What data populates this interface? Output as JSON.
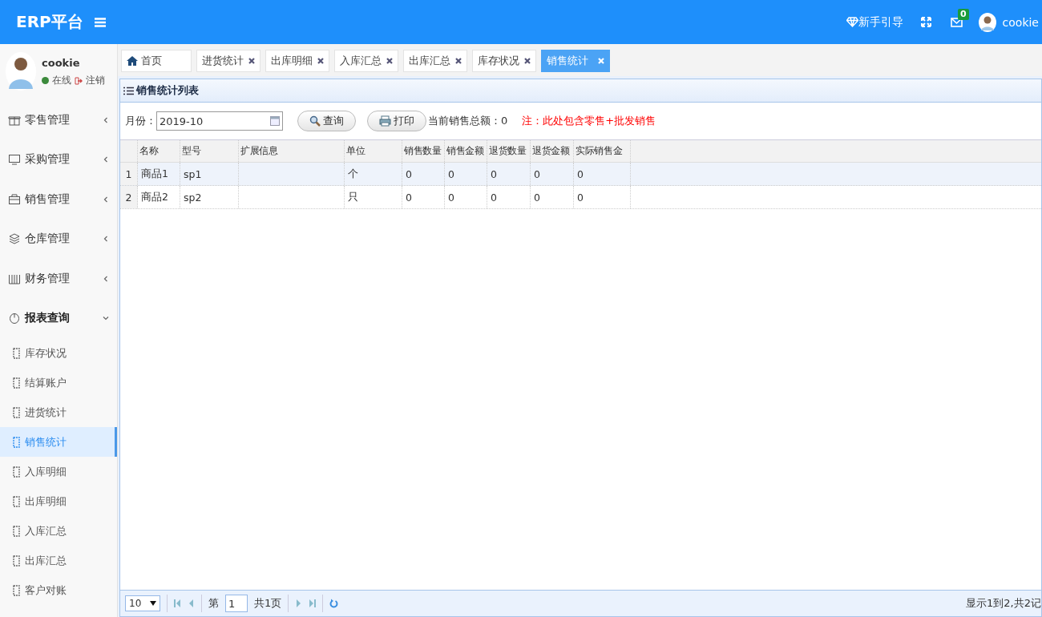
{
  "header": {
    "title": "ERP平台",
    "guide_label": "新手引导",
    "message_count": "0",
    "user_name": "cookie"
  },
  "profile": {
    "name": "cookie",
    "status": "在线",
    "logout": "注销"
  },
  "sidebar": [
    {
      "label": "零售管理",
      "expanded": false
    },
    {
      "label": "采购管理",
      "expanded": false
    },
    {
      "label": "销售管理",
      "expanded": false
    },
    {
      "label": "仓库管理",
      "expanded": false
    },
    {
      "label": "财务管理",
      "expanded": false
    },
    {
      "label": "报表查询",
      "expanded": true,
      "children": [
        {
          "label": "库存状况",
          "selected": false
        },
        {
          "label": "结算账户",
          "selected": false
        },
        {
          "label": "进货统计",
          "selected": false
        },
        {
          "label": "销售统计",
          "selected": true
        },
        {
          "label": "入库明细",
          "selected": false
        },
        {
          "label": "出库明细",
          "selected": false
        },
        {
          "label": "入库汇总",
          "selected": false
        },
        {
          "label": "出库汇总",
          "selected": false
        },
        {
          "label": "客户对账",
          "selected": false
        }
      ]
    }
  ],
  "tabs": [
    {
      "label": "首页",
      "selected": false,
      "kind": "home"
    },
    {
      "label": "进货统计",
      "selected": false,
      "kind": "closable"
    },
    {
      "label": "出库明细",
      "selected": false,
      "kind": "closable"
    },
    {
      "label": "入库汇总",
      "selected": false,
      "kind": "closable"
    },
    {
      "label": "出库汇总",
      "selected": false,
      "kind": "closable"
    },
    {
      "label": "库存状况",
      "selected": false,
      "kind": "closable"
    },
    {
      "label": "销售统计",
      "selected": true,
      "kind": "closable"
    }
  ],
  "panel": {
    "title": "销售统计列表",
    "month_label": "月份：",
    "month_value": "2019-10",
    "query_button": "查询",
    "print_button": "打印",
    "total_text": "当前销售总额：0",
    "note": "注：此处包含零售+批发销售"
  },
  "table": {
    "columns": [
      "名称",
      "型号",
      "扩展信息",
      "单位",
      "销售数量",
      "销售金额",
      "退货数量",
      "退货金额",
      "实际销售金"
    ],
    "rows": [
      {
        "index": "1",
        "cells": [
          "商品1",
          "sp1",
          "",
          "个",
          "0",
          "0",
          "0",
          "0",
          "0"
        ]
      },
      {
        "index": "2",
        "cells": [
          "商品2",
          "sp2",
          "",
          "只",
          "0",
          "0",
          "0",
          "0",
          "0"
        ]
      }
    ]
  },
  "pager": {
    "page_size": "10",
    "page_prefix": "第",
    "page": "1",
    "total_pages": "共1页",
    "summary": "显示1到2,共2记"
  }
}
